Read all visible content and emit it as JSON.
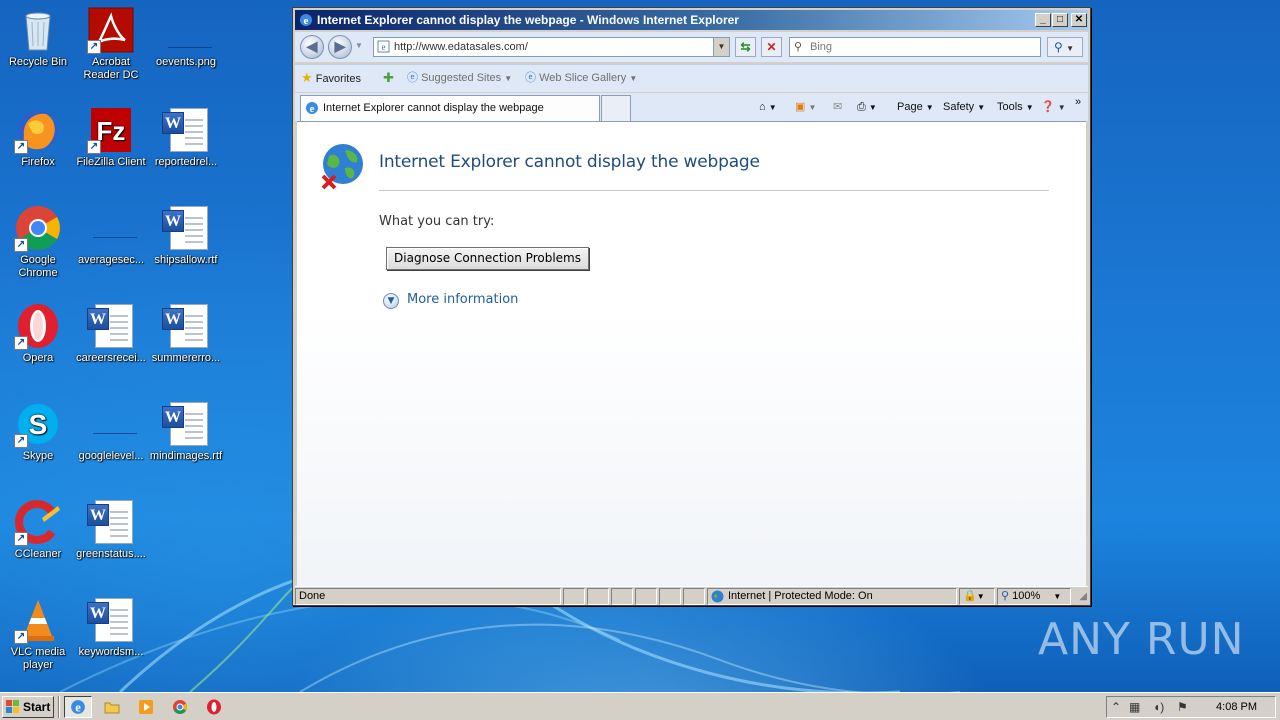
{
  "desktop": {
    "icons": [
      {
        "label": "Recycle Bin",
        "icon": "recycle-bin-icon"
      },
      {
        "label": "Acrobat Reader DC",
        "label_line1": "Acrobat",
        "label_line2": "Reader DC",
        "icon": "acrobat-icon"
      },
      {
        "label": "oevents.png",
        "icon": "image-file-icon"
      },
      {
        "label": "Firefox",
        "icon": "firefox-icon"
      },
      {
        "label": "FileZilla Client",
        "icon": "filezilla-icon"
      },
      {
        "label": "reportedrel...",
        "icon": "word-doc-icon"
      },
      {
        "label": "Google Chrome",
        "label_line1": "Google",
        "label_line2": "Chrome",
        "icon": "chrome-icon"
      },
      {
        "label": "averagesec...",
        "icon": "blank-file-icon"
      },
      {
        "label": "shipsallow.rtf",
        "icon": "word-doc-icon"
      },
      {
        "label": "Opera",
        "icon": "opera-icon"
      },
      {
        "label": "careersrecei...",
        "icon": "word-doc-icon"
      },
      {
        "label": "summererro...",
        "icon": "word-doc-icon"
      },
      {
        "label": "Skype",
        "icon": "skype-icon"
      },
      {
        "label": "googlelevel...",
        "icon": "blank-file-icon"
      },
      {
        "label": "mindimages.rtf",
        "icon": "word-doc-icon"
      },
      {
        "label": "CCleaner",
        "icon": "ccleaner-icon"
      },
      {
        "label": "greenstatus....",
        "icon": "word-doc-icon"
      },
      {
        "label": "VLC media player",
        "label_line1": "VLC media",
        "label_line2": "player",
        "icon": "vlc-icon"
      },
      {
        "label": "keywordsm...",
        "icon": "word-doc-icon"
      }
    ]
  },
  "ie": {
    "title": "Internet Explorer cannot display the webpage - Windows Internet Explorer",
    "address": "http://www.edatasales.com/",
    "search_placeholder": "Bing",
    "favorites_label": "Favorites",
    "suggested_sites": "Suggested Sites",
    "web_slice_gallery": "Web Slice Gallery",
    "tab_title": "Internet Explorer cannot display the webpage",
    "commands": {
      "page": "Page",
      "safety": "Safety",
      "tools": "Tools"
    },
    "content": {
      "heading": "Internet Explorer cannot display the webpage",
      "what_you_can_try": "What you can try:",
      "diagnose_button": "Diagnose Connection Problems",
      "more_information": "More information"
    },
    "status": {
      "text": "Done",
      "zone": "Internet | Protected Mode: On",
      "zoom": "100%"
    }
  },
  "taskbar": {
    "start_label": "Start",
    "clock": "4:08 PM"
  },
  "watermark": "ANY RUN"
}
